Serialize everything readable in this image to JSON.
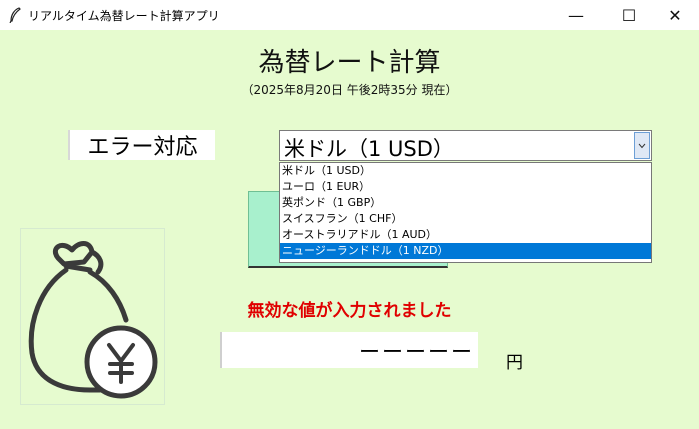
{
  "window": {
    "title": "リアルタイム為替レート計算アプリ",
    "minimize": "—",
    "maximize": "☐",
    "close": "✕"
  },
  "header": {
    "title": "為替レート計算",
    "subtitle": "（2025年8月20日 午後2時35分 現在）"
  },
  "amount_input": {
    "value": "エラー対応"
  },
  "currency_select": {
    "selected": "米ドル（1 USD）",
    "options": [
      "米ドル（1 USD）",
      "ユーロ（1 EUR）",
      "英ポンド（1 GBP）",
      "スイスフラン（1 CHF）",
      "オーストラリアドル（1 AUD）",
      "ニュージーランドドル（1 NZD）"
    ],
    "highlighted_index": 5
  },
  "error": {
    "message": "無効な値が入力されました"
  },
  "result": {
    "value": "ーーーーー",
    "unit": "円"
  },
  "colors": {
    "background": "#e6fbcf",
    "error": "#e00000",
    "button": "#a8f0cd",
    "highlight": "#0078d7"
  },
  "icons": {
    "app": "feather-icon",
    "illustration": "money-bag-yen-icon"
  }
}
